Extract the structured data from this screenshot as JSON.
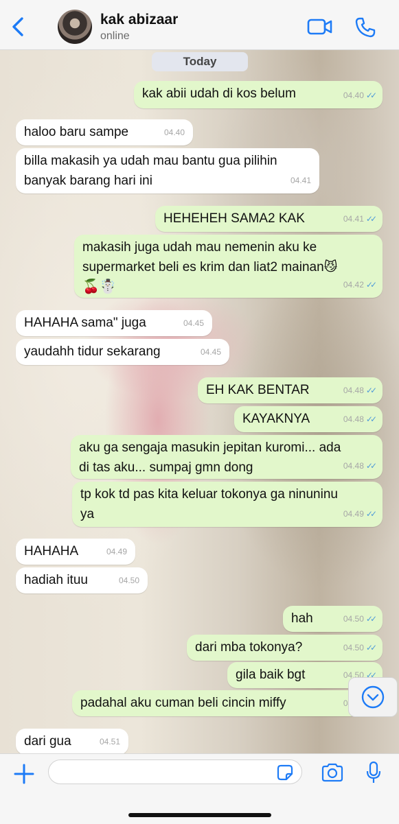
{
  "header": {
    "contact_name": "kak abizaar",
    "status": "online"
  },
  "chat": {
    "date_label": "Today",
    "messages": [
      {
        "dir": "out",
        "text": "kak abii udah di kos belum",
        "time": "04.40"
      },
      {
        "dir": "in",
        "text": "haloo baru sampe",
        "time": "04.40"
      },
      {
        "dir": "in",
        "lines": [
          "billa makasih ya udah mau bantu gua pilihin",
          "banyak barang hari ini"
        ],
        "time": "04.41"
      },
      {
        "dir": "out",
        "text": "HEHEHEH SAMA2 KAK",
        "time": "04.41"
      },
      {
        "dir": "out",
        "lines": [
          "makasih juga udah mau nemenin aku ke",
          "supermarket beli es krim dan liat2 mainan😼"
        ],
        "emoji": "🍒☃️",
        "time": "04.42"
      },
      {
        "dir": "in",
        "text": "HAHAHA sama\" juga",
        "time": "04.45"
      },
      {
        "dir": "in",
        "text": "yaudahh tidur sekarang",
        "time": "04.45"
      },
      {
        "dir": "out",
        "text": "EH KAK BENTAR",
        "time": "04.48"
      },
      {
        "dir": "out",
        "text": "KAYAKNYA",
        "time": "04.48"
      },
      {
        "dir": "out",
        "lines": [
          "aku ga sengaja masukin jepitan kuromi... ada",
          "di tas aku... sumpaj gmn dong"
        ],
        "time": "04.48"
      },
      {
        "dir": "out",
        "lines": [
          "tp kok td pas kita keluar tokonya ga ninuninu",
          "ya"
        ],
        "time": "04.49"
      },
      {
        "dir": "in",
        "text": "HAHAHA",
        "time": "04.49"
      },
      {
        "dir": "in",
        "text": "hadiah ituu",
        "time": "04.50"
      },
      {
        "dir": "out",
        "text": "hah",
        "time": "04.50"
      },
      {
        "dir": "out",
        "text": "dari mba tokonya?",
        "time": "04.50"
      },
      {
        "dir": "out",
        "text": "gila baik bgt",
        "time": "04.50"
      },
      {
        "dir": "out",
        "text": "padahal aku cuman beli cincin miffy",
        "time": "04.50"
      },
      {
        "dir": "in",
        "text": "dari gua",
        "time": "04.51"
      }
    ]
  },
  "colors": {
    "accent": "#1d7bf6",
    "outgoing_bubble": "#e2f7cb",
    "incoming_bubble": "#ffffff",
    "read_ticks": "#4f9bd9"
  },
  "icons": {
    "back": "chevron-left-icon",
    "video": "video-camera-icon",
    "call": "phone-icon",
    "scroll": "chevron-down-circle-icon",
    "attach": "plus-icon",
    "sticker": "sticker-icon",
    "camera": "camera-icon",
    "mic": "microphone-icon"
  },
  "composer": {
    "placeholder": ""
  }
}
